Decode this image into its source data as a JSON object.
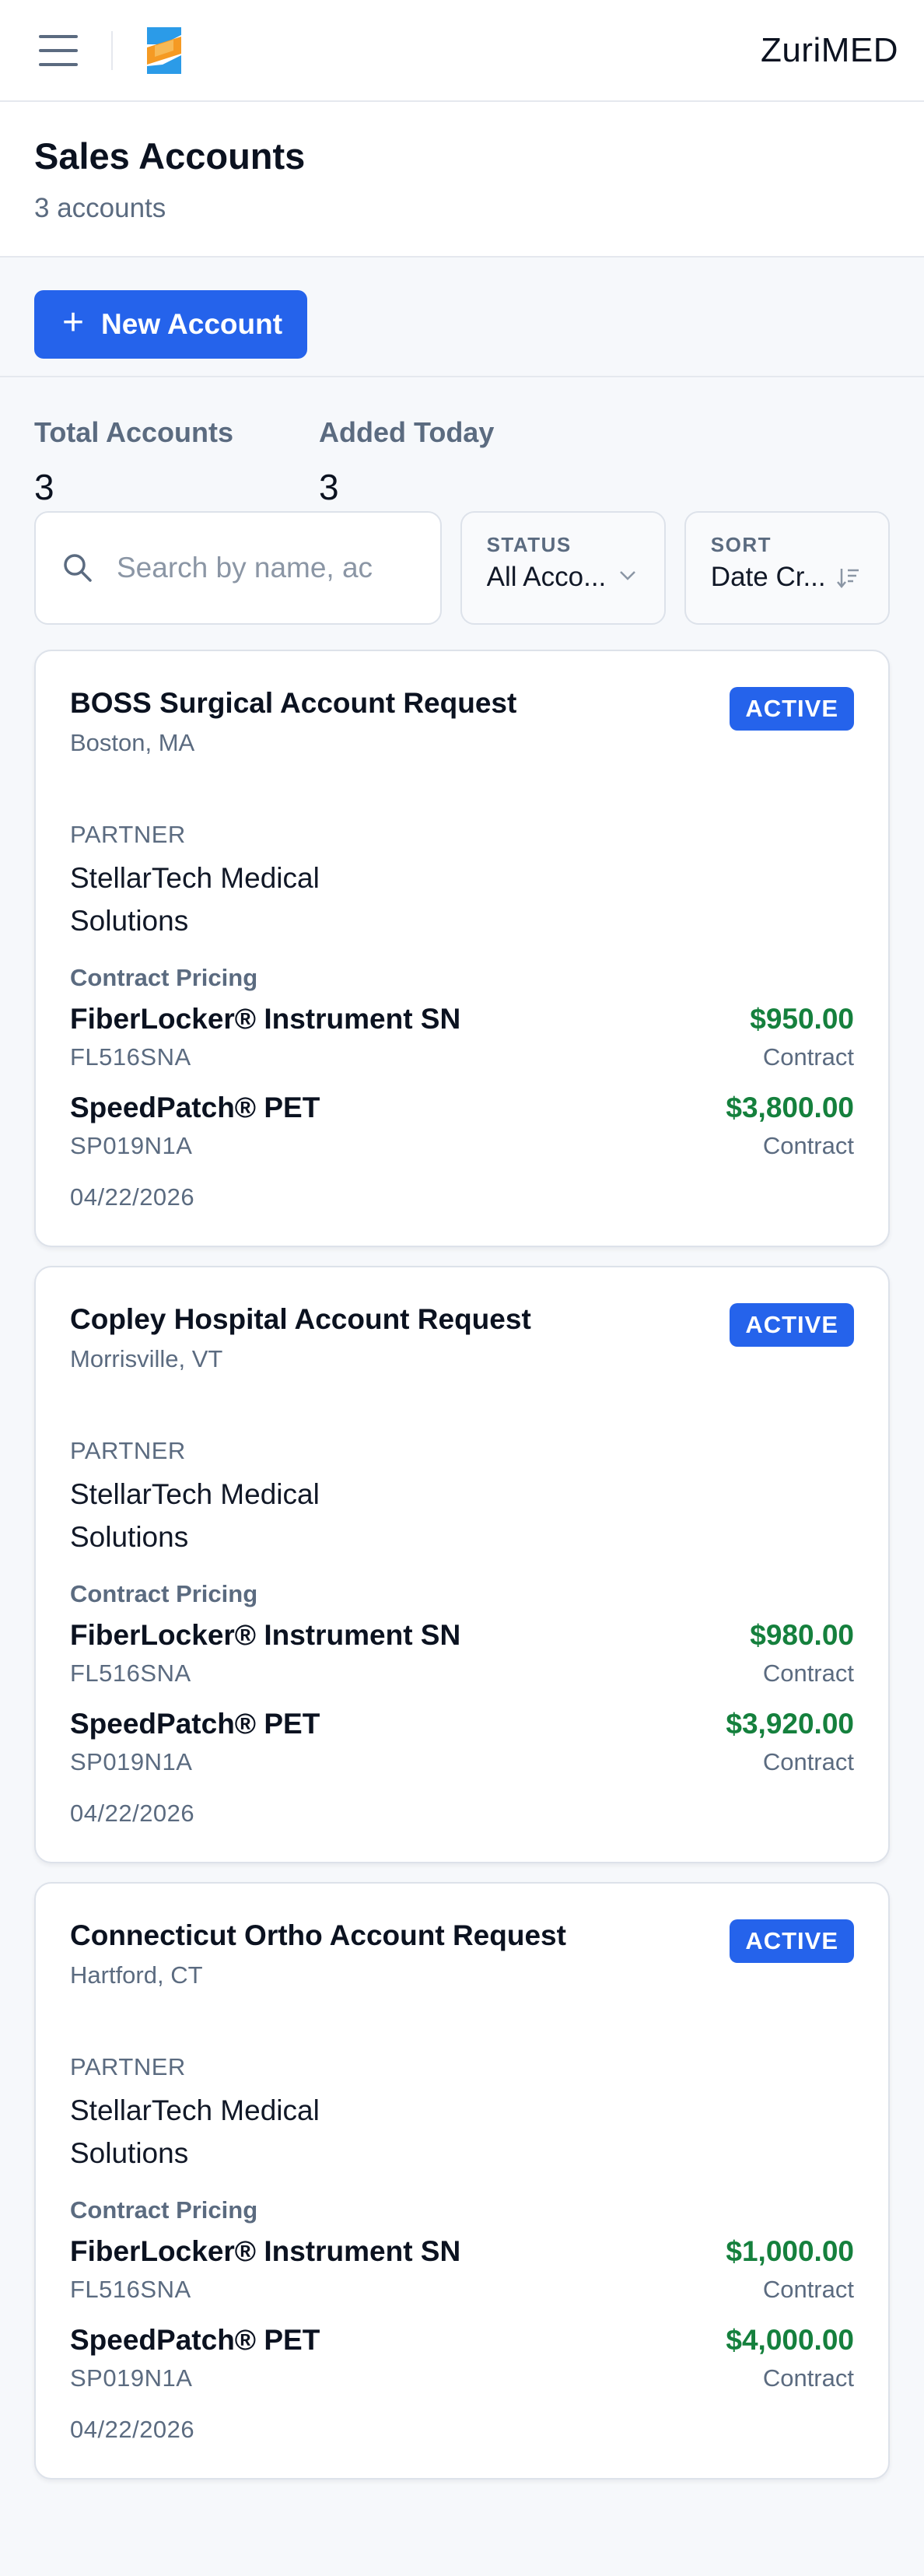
{
  "topbar": {
    "brand": "ZuriMED"
  },
  "header": {
    "title": "Sales Accounts",
    "subtitle": "3 accounts"
  },
  "actions": {
    "new_account_label": "New Account"
  },
  "stats": [
    {
      "label": "Total Accounts",
      "value": "3"
    },
    {
      "label": "Added Today",
      "value": "3"
    }
  ],
  "filters": {
    "search_placeholder": "Search by name, ac",
    "status_label": "STATUS",
    "status_value": "All Acco...",
    "sort_label": "SORT",
    "sort_value": "Date Cr..."
  },
  "colors": {
    "accent": "#2563eb",
    "price": "#15803d",
    "muted": "#5b6b80"
  },
  "accounts": [
    {
      "title": "BOSS Surgical Account Request",
      "location": "Boston, MA",
      "status": "ACTIVE",
      "partner_label": "PARTNER",
      "partner": "StellarTech Medical Solutions",
      "pricing_label": "Contract Pricing",
      "items": [
        {
          "name": "FiberLocker® Instrument SN",
          "sku": "FL516SNA",
          "price": "$950.00",
          "type": "Contract"
        },
        {
          "name": "SpeedPatch® PET",
          "sku": "SP019N1A",
          "price": "$3,800.00",
          "type": "Contract"
        }
      ],
      "date": "04/22/2026"
    },
    {
      "title": "Copley Hospital Account Request",
      "location": "Morrisville, VT",
      "status": "ACTIVE",
      "partner_label": "PARTNER",
      "partner": "StellarTech Medical Solutions",
      "pricing_label": "Contract Pricing",
      "items": [
        {
          "name": "FiberLocker® Instrument SN",
          "sku": "FL516SNA",
          "price": "$980.00",
          "type": "Contract"
        },
        {
          "name": "SpeedPatch® PET",
          "sku": "SP019N1A",
          "price": "$3,920.00",
          "type": "Contract"
        }
      ],
      "date": "04/22/2026"
    },
    {
      "title": "Connecticut Ortho Account Request",
      "location": "Hartford, CT",
      "status": "ACTIVE",
      "partner_label": "PARTNER",
      "partner": "StellarTech Medical Solutions",
      "pricing_label": "Contract Pricing",
      "items": [
        {
          "name": "FiberLocker® Instrument SN",
          "sku": "FL516SNA",
          "price": "$1,000.00",
          "type": "Contract"
        },
        {
          "name": "SpeedPatch® PET",
          "sku": "SP019N1A",
          "price": "$4,000.00",
          "type": "Contract"
        }
      ],
      "date": "04/22/2026"
    }
  ]
}
